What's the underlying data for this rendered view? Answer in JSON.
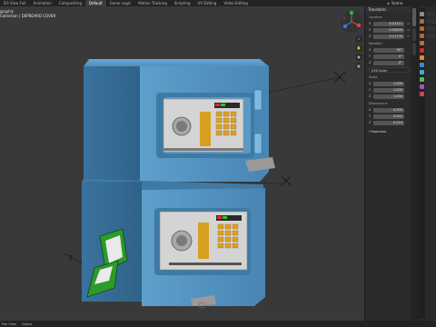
{
  "workspace_tabs": [
    "D3 View Full",
    "Animation",
    "Compositing",
    "Default",
    "Game Logic",
    "Motion Tracking",
    "Scripting",
    "UV Editing",
    "Video Editing"
  ],
  "active_tab": "Default",
  "scene": {
    "name": "Scene"
  },
  "viewport": {
    "view_label": "graphic",
    "collection_label": "Collection | DEPBOARD COVER"
  },
  "npanel": {
    "header": "Transform",
    "location_label": "Location",
    "location": [
      {
        "axis": "X",
        "value": "0.03111",
        "unit": "m"
      },
      {
        "axis": "Y",
        "value": "0.00000",
        "unit": "m"
      },
      {
        "axis": "Z",
        "value": "0.11778",
        "unit": "m"
      }
    ],
    "rotation_label": "Rotation",
    "rotation": [
      {
        "axis": "X",
        "value": "90°",
        "unit": ""
      },
      {
        "axis": "Y",
        "value": "0°",
        "unit": ""
      },
      {
        "axis": "Z",
        "value": "0°",
        "unit": ""
      }
    ],
    "rotation_mode": "XYZ Euler",
    "scale_label": "Scale",
    "scale": [
      {
        "axis": "X",
        "value": "1.000",
        "unit": ""
      },
      {
        "axis": "Y",
        "value": "1.000",
        "unit": ""
      },
      {
        "axis": "Z",
        "value": "1.000",
        "unit": ""
      }
    ],
    "dimensions_label": "Dimensions",
    "dimensions": [
      {
        "axis": "X",
        "value": "0.000",
        "unit": ""
      },
      {
        "axis": "Y",
        "value": "0.002",
        "unit": ""
      },
      {
        "axis": "Z",
        "value": "0.010",
        "unit": ""
      }
    ],
    "properties_label": "Properties"
  },
  "nav_buttons": [
    "search-icon",
    "hand-icon",
    "camera-icon",
    "grid-icon"
  ],
  "status_bar": {
    "left": "Pan View",
    "right": "Object"
  },
  "colors": {
    "safe_body": "#5d9cc7",
    "safe_dark": "#3c78a4",
    "keypad": "#e0a020",
    "panel": "#c8c8c8",
    "money": "#2c9a2c"
  }
}
